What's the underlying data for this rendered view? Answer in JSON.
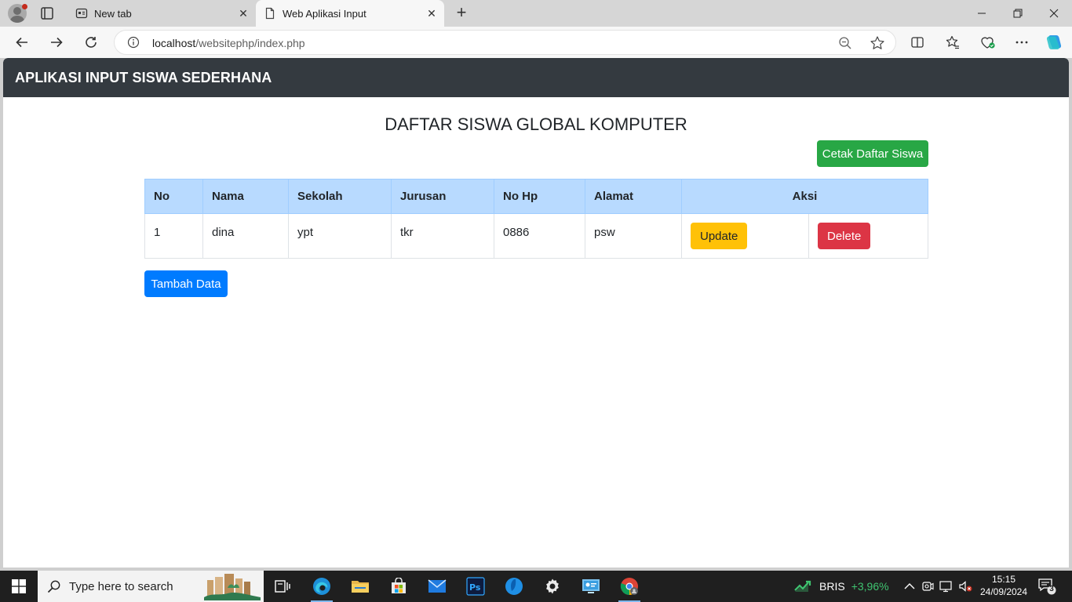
{
  "browser": {
    "tabs": [
      {
        "title": "New tab",
        "active": false
      },
      {
        "title": "Web Aplikasi Input",
        "active": true
      }
    ],
    "address": {
      "host": "localhost",
      "path": "/websitephp/index.php"
    }
  },
  "page": {
    "brand": "APLIKASI INPUT SISWA SEDERHANA",
    "title": "DAFTAR SISWA GLOBAL KOMPUTER",
    "print_button": "Cetak Daftar Siswa",
    "add_button": "Tambah Data",
    "table": {
      "headers": [
        "No",
        "Nama",
        "Sekolah",
        "Jurusan",
        "No Hp",
        "Alamat",
        "Aksi"
      ],
      "rows": [
        {
          "no": "1",
          "nama": "dina",
          "sekolah": "ypt",
          "jurusan": "tkr",
          "no_hp": "0886",
          "alamat": "psw",
          "update": "Update",
          "delete": "Delete"
        }
      ]
    }
  },
  "taskbar": {
    "search_placeholder": "Type here to search",
    "stock": {
      "ticker": "BRIS",
      "change": "+3,96%"
    },
    "time": "15:15",
    "date": "24/09/2024",
    "notification_count": "3"
  }
}
